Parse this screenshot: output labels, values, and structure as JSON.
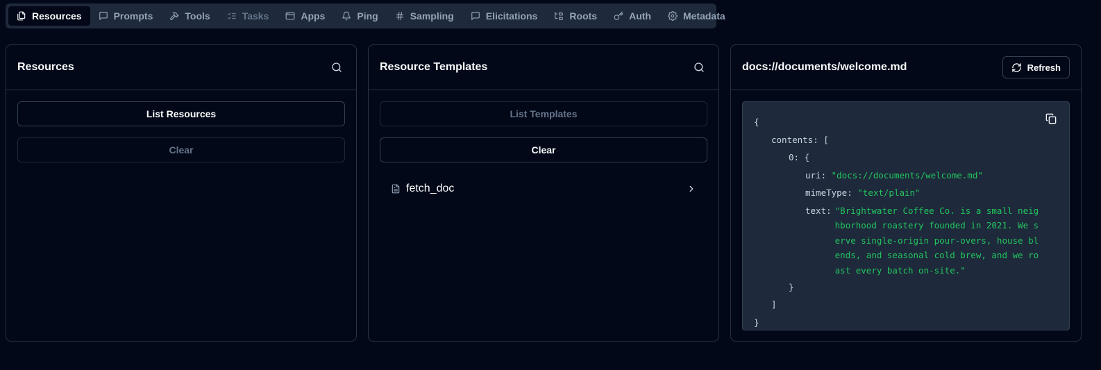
{
  "tabs": [
    {
      "label": "Resources",
      "icon": "files-icon",
      "state": "active"
    },
    {
      "label": "Prompts",
      "icon": "message-icon",
      "state": "normal"
    },
    {
      "label": "Tools",
      "icon": "hammer-icon",
      "state": "normal"
    },
    {
      "label": "Tasks",
      "icon": "list-checks-icon",
      "state": "disabled"
    },
    {
      "label": "Apps",
      "icon": "app-window-icon",
      "state": "normal"
    },
    {
      "label": "Ping",
      "icon": "bell-icon",
      "state": "normal"
    },
    {
      "label": "Sampling",
      "icon": "hash-icon",
      "state": "normal"
    },
    {
      "label": "Elicitations",
      "icon": "message-icon",
      "state": "normal"
    },
    {
      "label": "Roots",
      "icon": "folder-tree-icon",
      "state": "normal"
    },
    {
      "label": "Auth",
      "icon": "key-icon",
      "state": "normal"
    },
    {
      "label": "Metadata",
      "icon": "gear-icon",
      "state": "normal"
    }
  ],
  "resources_panel": {
    "title": "Resources",
    "list_button": "List Resources",
    "clear_button": "Clear"
  },
  "templates_panel": {
    "title": "Resource Templates",
    "list_button": "List Templates",
    "clear_button": "Clear",
    "items": [
      {
        "name": "fetch_doc"
      }
    ]
  },
  "content_panel": {
    "title": "docs://documents/welcome.md",
    "refresh_button": "Refresh",
    "json": {
      "open_brace": "{",
      "contents_key": "contents:",
      "open_bracket": "[",
      "index_key": "0:",
      "inner_open": "{",
      "uri_key": "uri:",
      "uri_value": "\"docs://documents/welcome.md\"",
      "mime_key": "mimeType:",
      "mime_value": "\"text/plain\"",
      "text_key": "text:",
      "text_value": "\"Brightwater Coffee Co. is a small neighborhood roastery founded in 2021. We serve single-origin pour-overs, house blends, and seasonal cold brew, and we roast every batch on-site.\"",
      "inner_close": "}",
      "close_bracket": "]",
      "close_brace": "}"
    }
  },
  "colors": {
    "background": "#020817",
    "tabbar": "#1e293b",
    "json_string": "#22c55e",
    "border": "#2a3343"
  }
}
